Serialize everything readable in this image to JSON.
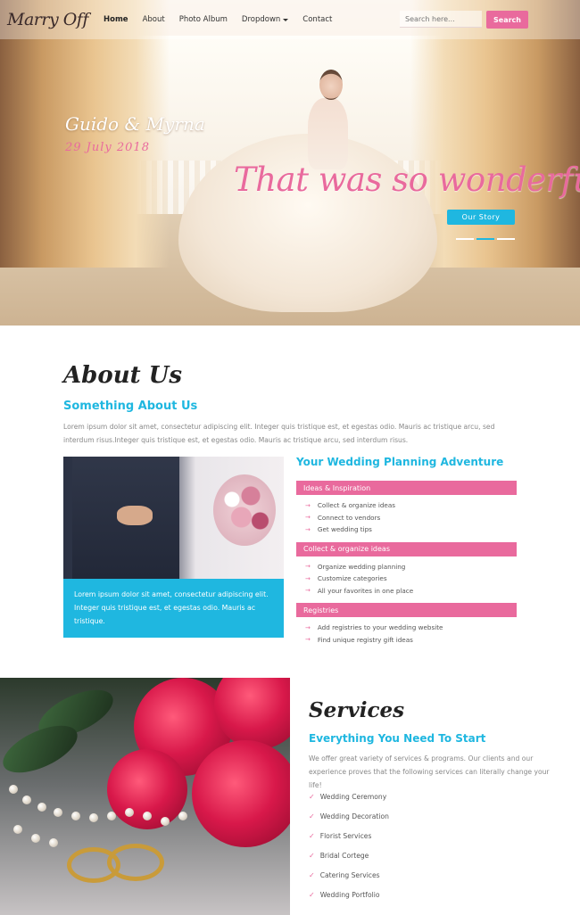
{
  "nav": {
    "logo": "Marry Off",
    "items": [
      {
        "label": "Home",
        "active": true
      },
      {
        "label": "About"
      },
      {
        "label": "Photo Album"
      },
      {
        "label": "Dropdown",
        "has_caret": true
      },
      {
        "label": "Contact"
      }
    ],
    "search_placeholder": "Search here...",
    "search_button": "Search"
  },
  "hero": {
    "couple": "Guido & Myrna",
    "date": "29 July 2018",
    "tagline": "That was so wonderful",
    "button": "Our Story",
    "slides_total": 3,
    "active_slide": 2
  },
  "about": {
    "title": "About Us",
    "subtitle": "Something About Us",
    "text": "Lorem ipsum dolor sit amet, consectetur adipiscing elit. Integer quis tristique est, et egestas odio. Mauris ac tristique arcu, sed interdum risus.Integer quis tristique est, et egestas odio. Mauris ac tristique arcu, sed interdum risus.",
    "caption": "Lorem ipsum dolor sit amet, consectetur adipiscing elit. Integer quis tristique est, et egestas odio. Mauris ac tristique.",
    "planning_title": "Your Wedding Planning Adventure",
    "groups": [
      {
        "heading": "Ideas & Inspiration",
        "items": [
          "Collect & organize ideas",
          "Connect to vendors",
          "Get wedding tips"
        ]
      },
      {
        "heading": "Collect & organize ideas",
        "items": [
          "Organize wedding planning",
          "Customize categories",
          "All your favorites in one place"
        ]
      },
      {
        "heading": "Registries",
        "items": [
          "Add registries to your wedding website",
          "Find unique registry gift ideas"
        ]
      }
    ]
  },
  "services": {
    "title": "Services",
    "subtitle": "Everything You Need To Start",
    "text": "We offer great variety of services & programs. Our clients and our experience proves that the following services can literally change your life!",
    "items": [
      "Wedding Ceremony",
      "Wedding Decoration",
      "Florist Services",
      "Bridal Cortege",
      "Catering Services",
      "Wedding Portfolio"
    ]
  },
  "colors": {
    "accent_pink": "#e96a9d",
    "accent_blue": "#1fb7e0"
  }
}
